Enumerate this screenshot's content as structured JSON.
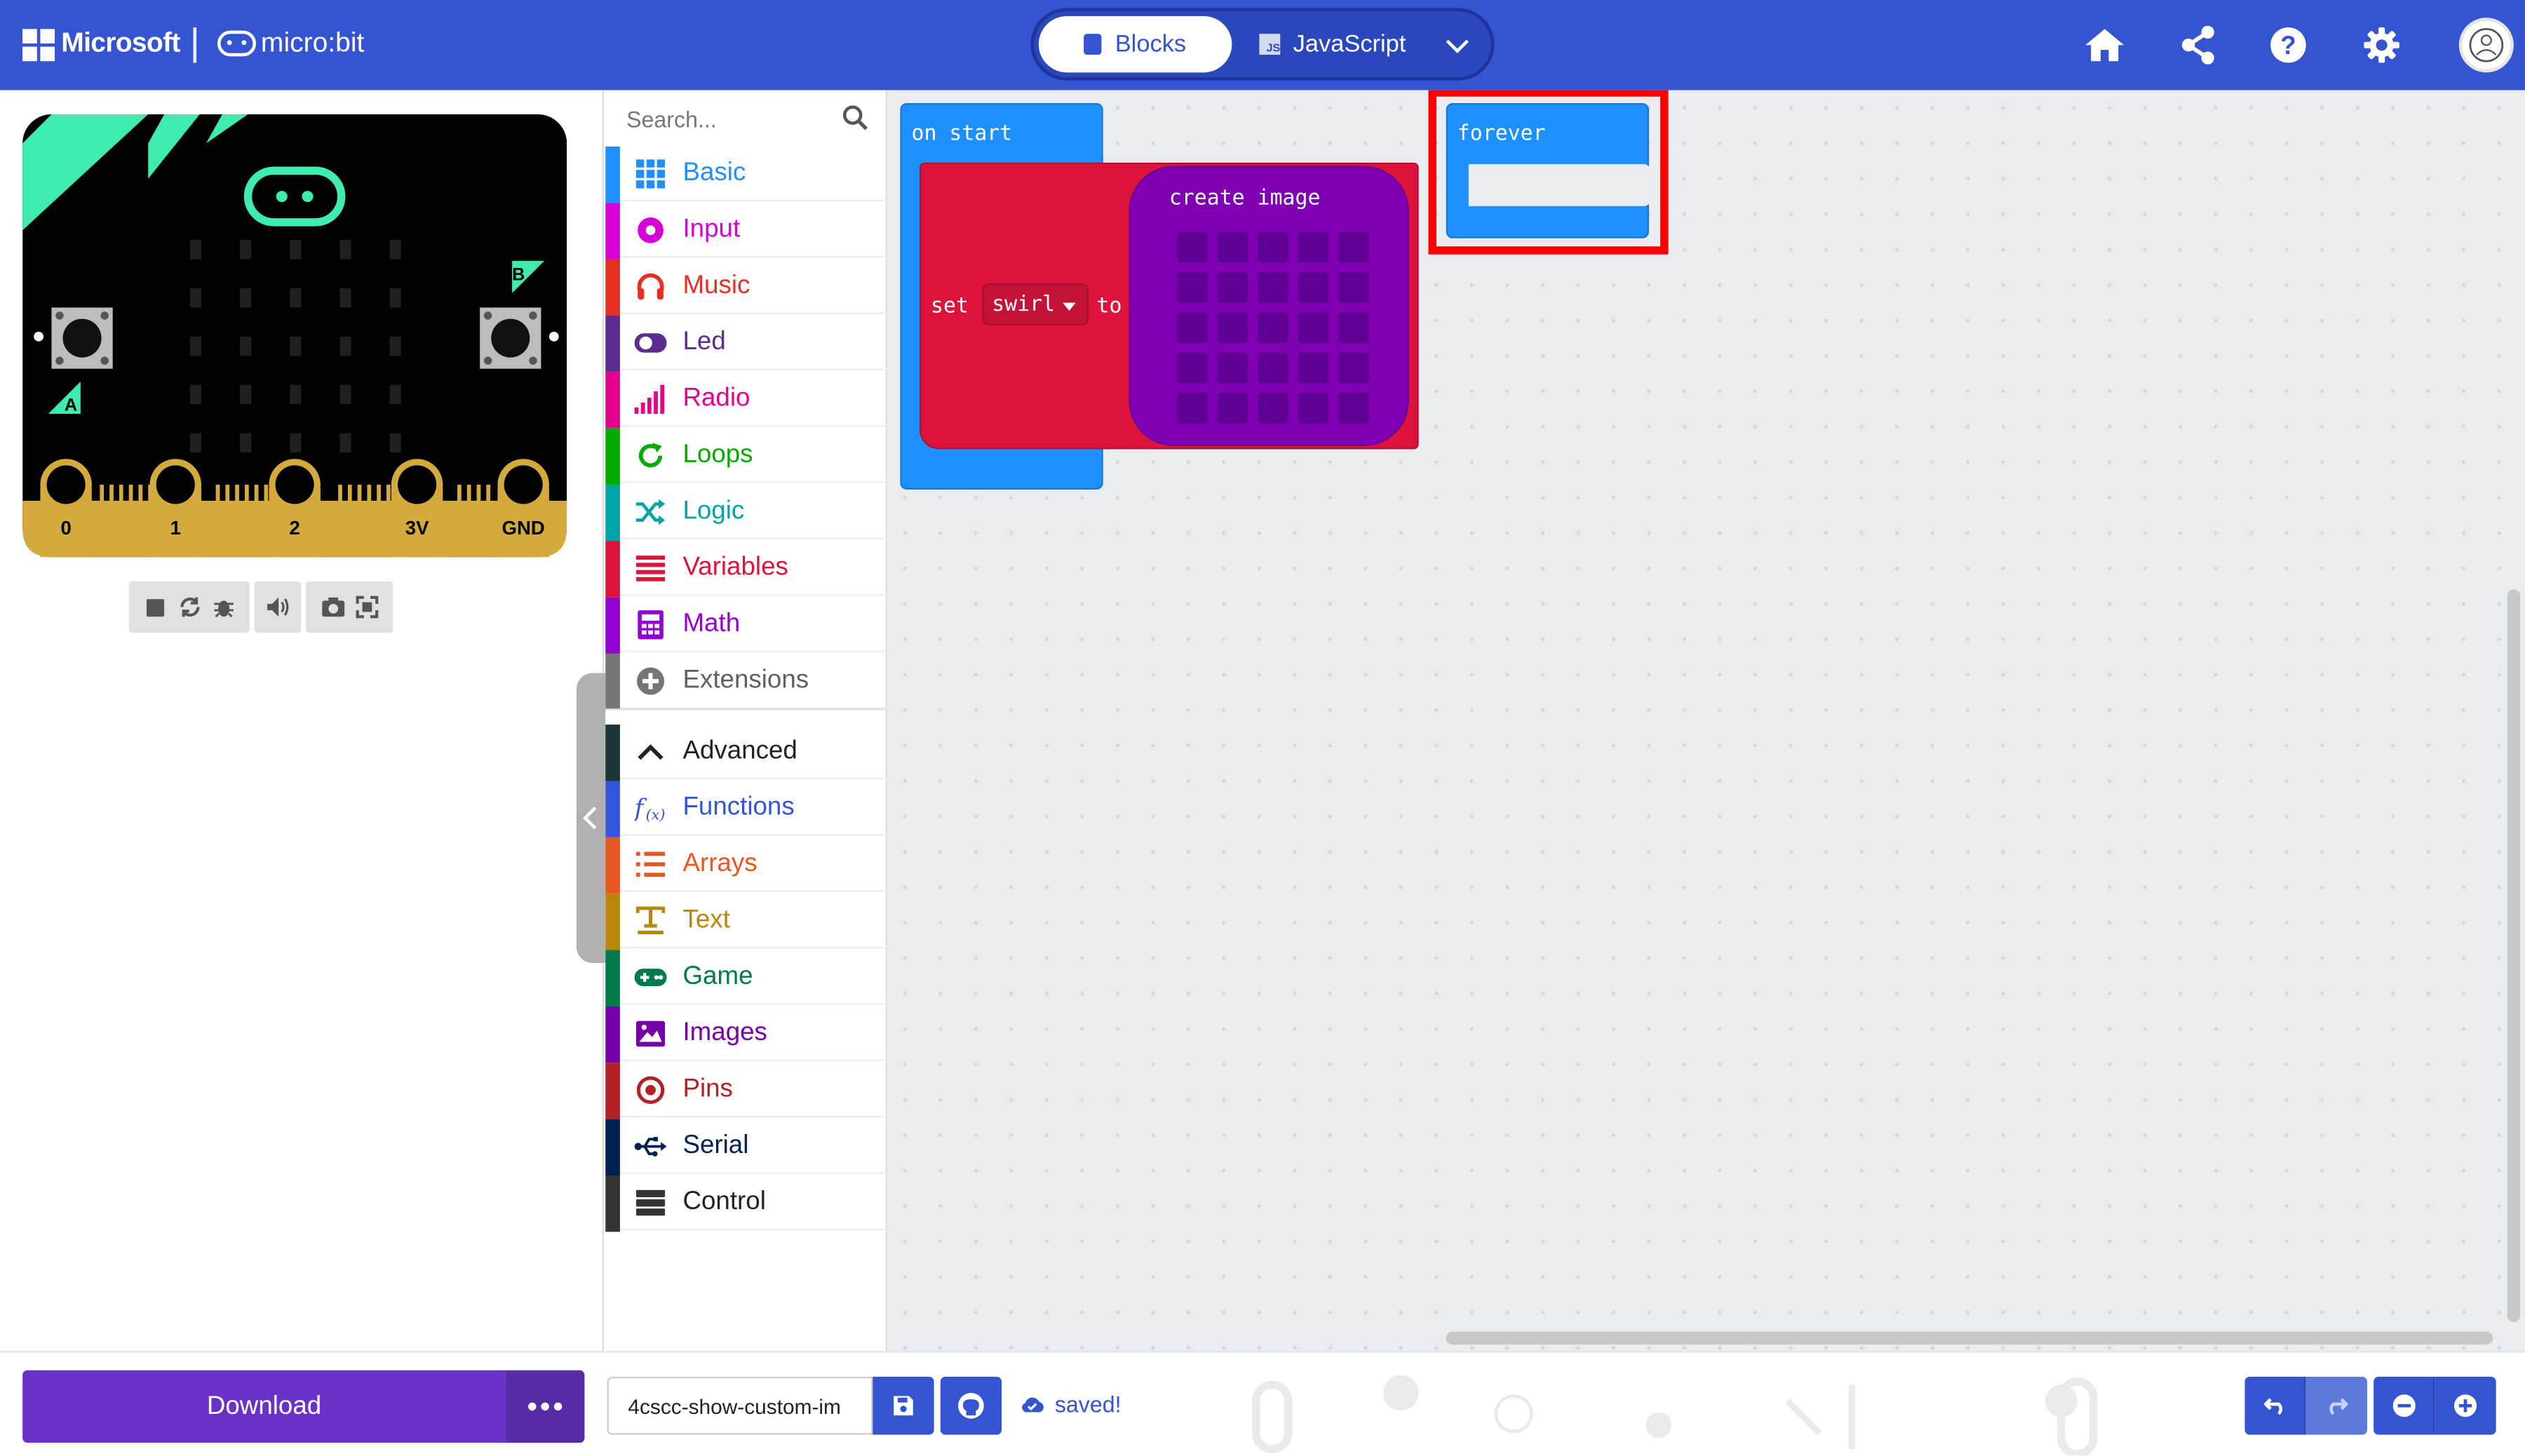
{
  "header": {
    "brand": "Microsoft",
    "product": "micro:bit",
    "tabs": [
      {
        "label": "Blocks",
        "active": true
      },
      {
        "label": "JavaScript",
        "active": false
      }
    ],
    "icons": [
      "home-icon",
      "share-icon",
      "help-icon",
      "settings-icon",
      "user-avatar"
    ],
    "accent_color": "#3454d1"
  },
  "simulator": {
    "pins": [
      "0",
      "1",
      "2",
      "3V",
      "GND"
    ],
    "buttons": [
      "A",
      "B"
    ],
    "controls": [
      "stop-icon",
      "restart-icon",
      "debug-icon",
      "mute-icon",
      "screenshot-icon",
      "fullscreen-icon"
    ]
  },
  "toolbox": {
    "search_placeholder": "Search...",
    "categories": [
      {
        "label": "Basic",
        "color": "#1e90ff",
        "icon": "grid-icon"
      },
      {
        "label": "Input",
        "color": "#d400d4",
        "icon": "radio-button-icon"
      },
      {
        "label": "Music",
        "color": "#e63022",
        "icon": "headphones-icon"
      },
      {
        "label": "Led",
        "color": "#5c2d91",
        "icon": "toggle-icon"
      },
      {
        "label": "Radio",
        "color": "#e3008c",
        "icon": "signal-bars-icon"
      },
      {
        "label": "Loops",
        "color": "#00aa00",
        "icon": "refresh-icon"
      },
      {
        "label": "Logic",
        "color": "#00a4a6",
        "icon": "shuffle-icon"
      },
      {
        "label": "Variables",
        "color": "#dc143c",
        "icon": "lines-icon"
      },
      {
        "label": "Math",
        "color": "#9400d3",
        "icon": "calculator-icon"
      },
      {
        "label": "Extensions",
        "color": "#757575",
        "icon": "plus-circle-icon"
      }
    ],
    "advanced_label": "Advanced",
    "advanced_categories": [
      {
        "label": "Functions",
        "color": "#3455db",
        "icon": "function-icon"
      },
      {
        "label": "Arrays",
        "color": "#e65722",
        "icon": "list-icon"
      },
      {
        "label": "Text",
        "color": "#b8860b",
        "icon": "text-icon"
      },
      {
        "label": "Game",
        "color": "#007a4b",
        "icon": "gamepad-icon"
      },
      {
        "label": "Images",
        "color": "#7600a8",
        "icon": "image-icon"
      },
      {
        "label": "Pins",
        "color": "#b22222",
        "icon": "target-icon"
      },
      {
        "label": "Serial",
        "color": "#002050",
        "icon": "usb-icon"
      },
      {
        "label": "Control",
        "color": "#333333",
        "icon": "server-icon"
      }
    ]
  },
  "workspace": {
    "on_start_label": "on start",
    "set_label": "set",
    "variable": "swirl",
    "to_label": "to",
    "create_image_label": "create image",
    "forever_label": "forever"
  },
  "footer": {
    "download_label": "Download",
    "project_name": "4cscc-show-custom-im",
    "saved_label": "saved!"
  }
}
